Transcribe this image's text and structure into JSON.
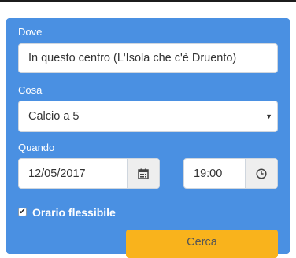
{
  "form": {
    "dove": {
      "label": "Dove",
      "value": "In questo centro (L'Isola che c'è Druento)"
    },
    "cosa": {
      "label": "Cosa",
      "selected": "Calcio a 5"
    },
    "quando": {
      "label": "Quando",
      "date": "12/05/2017",
      "time": "19:00"
    },
    "flessibile": {
      "label": "Orario flessibile",
      "checked": true,
      "check_glyph": "✔"
    },
    "submit": {
      "label": "Cerca"
    }
  },
  "icons": {
    "calendar": "calendar-icon",
    "clock": "clock-icon",
    "caret": "caret-down-icon"
  },
  "colors": {
    "panel": "#4a90e2",
    "button": "#f9b31c",
    "label_text": "#ffffff"
  }
}
